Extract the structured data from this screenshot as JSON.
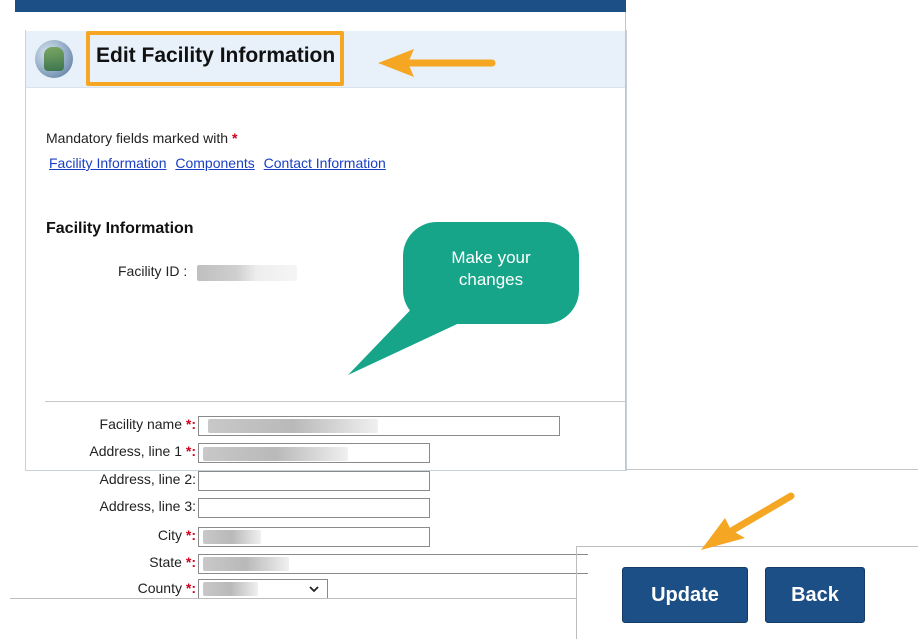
{
  "header": {
    "title": "Edit Facility Information"
  },
  "intro": {
    "mandatory_text": "Mandatory fields marked with",
    "mandatory_mark": "*"
  },
  "links": [
    {
      "label": "Facility Information"
    },
    {
      "label": "Components"
    },
    {
      "label": "Contact Information"
    }
  ],
  "section": {
    "title": "Facility Information"
  },
  "facility_id": {
    "label": "Facility ID :"
  },
  "callout": {
    "line1": "Make your",
    "line2": "changes"
  },
  "form": {
    "fields": [
      {
        "label": "Facility name",
        "required": true
      },
      {
        "label": "Address, line 1",
        "required": true
      },
      {
        "label": "Address, line 2",
        "required": false
      },
      {
        "label": "Address, line 3",
        "required": false
      },
      {
        "label": "City",
        "required": true
      },
      {
        "label": "State",
        "required": true
      },
      {
        "label": "County",
        "required": true
      }
    ],
    "req_suffix": "*:",
    "opt_suffix": ":"
  },
  "buttons": {
    "update": "Update",
    "back": "Back"
  },
  "colors": {
    "accent": "#1c4f86",
    "highlight": "#f5a623",
    "callout": "#17a589",
    "required": "#d0021b",
    "link": "#1a3fc4"
  }
}
